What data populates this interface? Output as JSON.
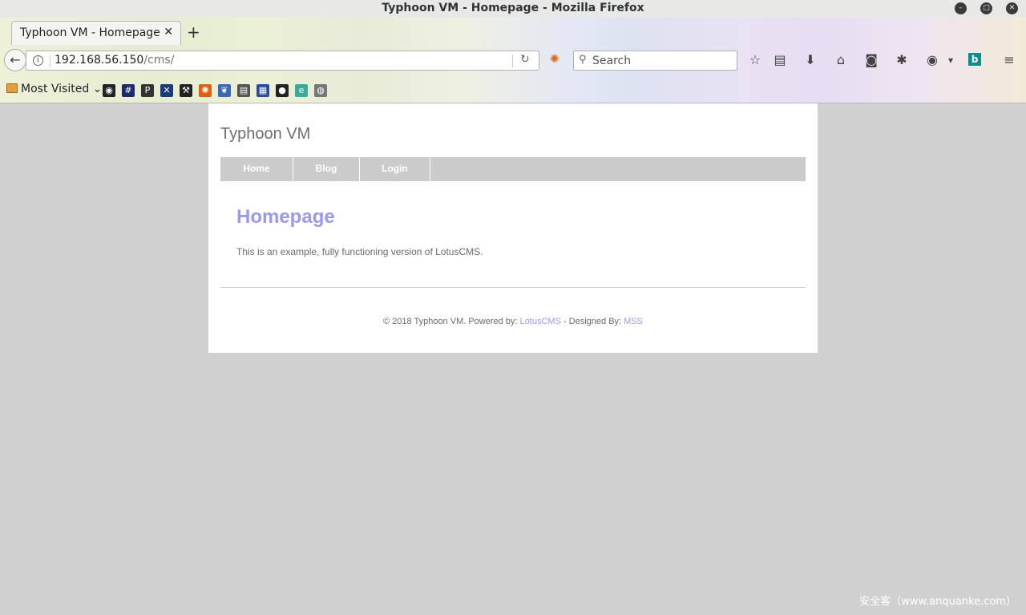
{
  "window": {
    "title": "Typhoon VM - Homepage - Mozilla Firefox",
    "minimize_glyph": "–",
    "maximize_glyph": "□",
    "close_glyph": "✕"
  },
  "tab": {
    "label": "Typhoon VM - Homepage",
    "close_glyph": "✕",
    "new_tab_glyph": "+"
  },
  "navbar": {
    "back_glyph": "←",
    "info_glyph": "i",
    "url_host": "192.168.56.150",
    "url_path": "/cms/",
    "reload_glyph": "↻",
    "search_placeholder": "Search",
    "icons": [
      "addon-icon",
      "star-icon",
      "reading-list-icon",
      "download-icon",
      "home-icon",
      "pocket-icon",
      "bug-icon",
      "vpn-icon",
      "chevron-down-icon",
      "bing-icon",
      "menu-icon"
    ]
  },
  "bookmarks": {
    "most_visited_label": "Most Visited",
    "items": [
      {
        "name": "kali-icon",
        "glyph": "◉",
        "color": "#222222"
      },
      {
        "name": "exploit-db-icon",
        "glyph": "#",
        "color": "#1a2a6e"
      },
      {
        "name": "pentest-p-icon",
        "glyph": "P",
        "color": "#333333"
      },
      {
        "name": "nethunter-icon",
        "glyph": "✕",
        "color": "#1a3a7a"
      },
      {
        "name": "tools-icon",
        "glyph": "⚒",
        "color": "#222222"
      },
      {
        "name": "firefox-icon",
        "glyph": "✺",
        "color": "#e06010"
      },
      {
        "name": "dragon-icon",
        "glyph": "❦",
        "color": "#3a6ab0"
      },
      {
        "name": "docs-icon",
        "glyph": "▤",
        "color": "#555555"
      },
      {
        "name": "map-icon",
        "glyph": "▦",
        "color": "#2a4a9a"
      },
      {
        "name": "github-icon",
        "glyph": "●",
        "color": "#222222"
      },
      {
        "name": "ghostery-icon",
        "glyph": "e",
        "color": "#3aaa9a"
      },
      {
        "name": "globe-icon",
        "glyph": "◍",
        "color": "#777777"
      }
    ]
  },
  "site": {
    "title": "Typhoon VM",
    "menu": [
      "Home",
      "Blog",
      "Login"
    ],
    "heading": "Homepage",
    "body": "This is an example, fully functioning version of LotusCMS.",
    "footer": {
      "prefix": "© 2018 Typhoon VM. Powered by: ",
      "powered_link": "LotusCMS",
      "middle": " - Designed By: ",
      "designer_link": "MSS"
    }
  },
  "watermark": "安全客（www.anquanke.com）",
  "colors": {
    "accent": "#9999ee",
    "menu_bg": "#cbcbcb",
    "page_bg": "#d0d0d0"
  }
}
